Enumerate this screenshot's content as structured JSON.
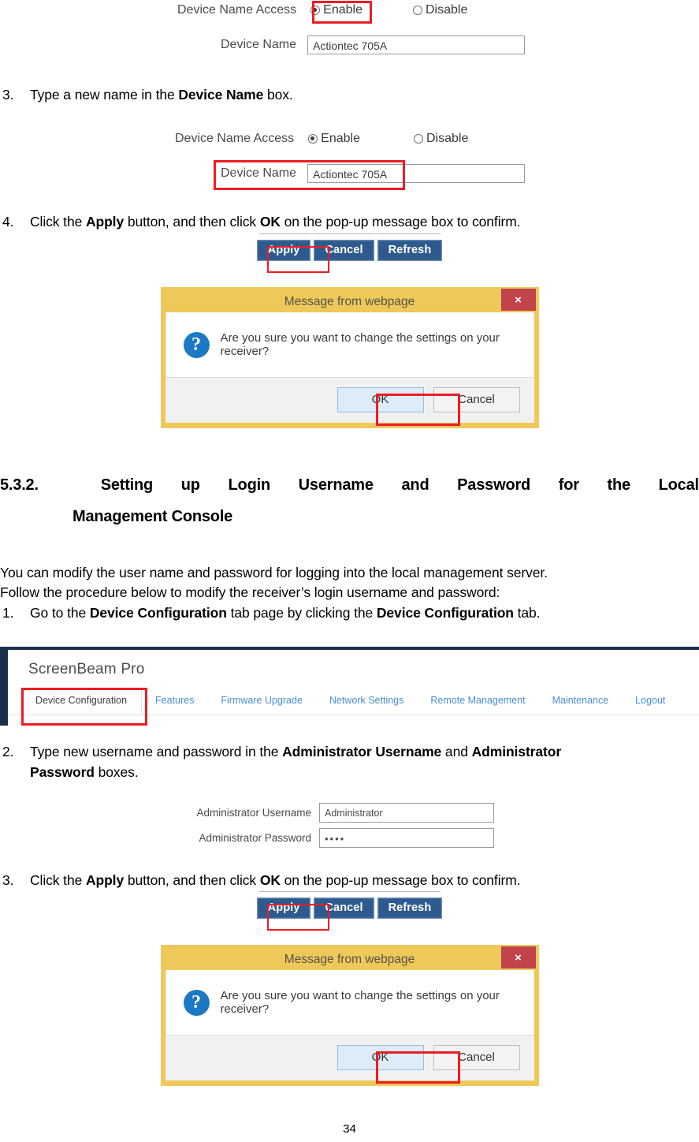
{
  "document": {
    "page_number": "34"
  },
  "shot1": {
    "access_label": "Device Name Access",
    "enable_label": "Enable",
    "disable_label": "Disable",
    "device_name_label": "Device Name",
    "device_name_value": "Actiontec 705A"
  },
  "step3_top": {
    "number": "3.",
    "text_before": "Type a new name in the ",
    "bold": "Device Name",
    "text_after": " box."
  },
  "shot2": {
    "access_label": "Device Name Access",
    "enable_label": "Enable",
    "disable_label": "Disable",
    "device_name_label": "Device Name",
    "device_name_value": "Actiontec 705A"
  },
  "step4_top": {
    "number": "4.",
    "t1": "Click the ",
    "b1": "Apply",
    "t2": " button, and then click ",
    "b2": "OK",
    "t3": " on the pop-up message box to confirm."
  },
  "buttonbar": {
    "apply": "Apply",
    "cancel": "Cancel",
    "refresh": "Refresh"
  },
  "dialog": {
    "title": "Message from webpage",
    "close_label": "×",
    "icon": "question-mark",
    "message": "Are you sure you want to change the settings on your receiver?",
    "ok": "OK",
    "cancel": "Cancel"
  },
  "heading": {
    "number": "5.3.2.",
    "line1_words": [
      "Setting",
      "up",
      "Login",
      "Username",
      "and",
      "Password",
      "for",
      "the",
      "Local"
    ],
    "line2": "Management Console"
  },
  "intro": {
    "line1": "You can modify the user name and password for logging into the local management server.",
    "line2": "Follow the procedure below to modify the receiver’s login username and password:"
  },
  "step1": {
    "number": "1.",
    "t1": "Go to the ",
    "b1": "Device Configuration",
    "t2": " tab page by clicking the ",
    "b2": "Device Configuration",
    "t3": " tab."
  },
  "screenbeam": {
    "app_title": "ScreenBeam Pro",
    "tabs": [
      {
        "label": "Device Configuration",
        "active": true
      },
      {
        "label": "Features",
        "active": false
      },
      {
        "label": "Firmware Upgrade",
        "active": false
      },
      {
        "label": "Network Settings",
        "active": false
      },
      {
        "label": "Remote Management",
        "active": false
      },
      {
        "label": "Maintenance",
        "active": false
      },
      {
        "label": "Logout",
        "active": false
      }
    ]
  },
  "step2": {
    "number": "2.",
    "t1": "Type new username and password in the ",
    "b1": "Administrator Username",
    "t2": " and ",
    "b2": "Administrator",
    "t3": "Password",
    "t4": " boxes."
  },
  "admin_form": {
    "username_label": "Administrator Username",
    "username_value": "Administrator",
    "password_label": "Administrator Password",
    "password_value": "••••"
  },
  "step3_bottom": {
    "number": "3.",
    "t1": "Click the ",
    "b1": "Apply",
    "t2": " button, and then click ",
    "b2": "OK",
    "t3": " on the pop-up message box to confirm."
  },
  "colors": {
    "dialog_frame": "#eec95a",
    "dialog_close": "#c0444a",
    "question_icon": "#1b79c3",
    "web_button": "#2e5a8e",
    "annotation_red": "#ee1c25",
    "tab_link": "#4a8ed6",
    "browser_chrome": "#1c2f4c"
  }
}
